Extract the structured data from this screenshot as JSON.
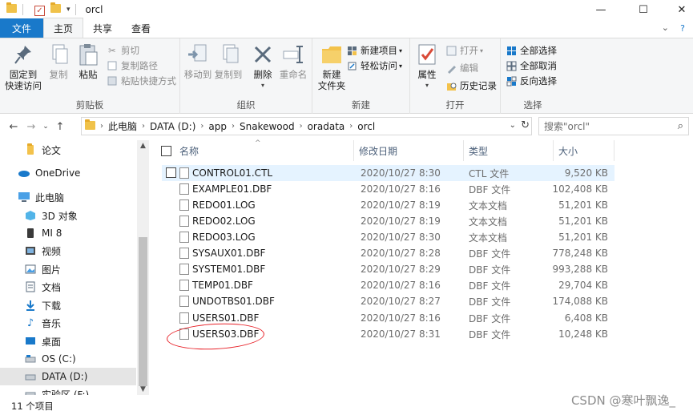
{
  "title": {
    "path_name": "orcl",
    "quick_access_dropdown": "▾"
  },
  "window_controls": {
    "minimize": "—",
    "maximize": "☐",
    "close": "✕"
  },
  "tabs": [
    {
      "label": "文件"
    },
    {
      "label": "主页"
    },
    {
      "label": "共享"
    },
    {
      "label": "查看"
    }
  ],
  "ribbon": {
    "clipboard": {
      "label": "剪贴板",
      "pin": "固定到\n快速访问",
      "copy": "复制",
      "paste": "粘贴",
      "cut": "剪切",
      "copy_path": "复制路径",
      "paste_shortcut": "粘贴快捷方式"
    },
    "organize": {
      "label": "组织",
      "move_to": "移动到",
      "copy_to": "复制到",
      "delete": "删除",
      "rename": "重命名"
    },
    "new": {
      "label": "新建",
      "new_folder": "新建\n文件夹",
      "new_item": "新建项目",
      "easy_access": "轻松访问"
    },
    "open": {
      "label": "打开",
      "properties": "属性",
      "open": "打开",
      "edit": "编辑",
      "history": "历史记录"
    },
    "select": {
      "label": "选择",
      "select_all": "全部选择",
      "select_none": "全部取消",
      "invert": "反向选择"
    }
  },
  "address": {
    "segments": [
      "此电脑",
      "DATA (D:)",
      "app",
      "Snakewood",
      "oradata",
      "orcl"
    ]
  },
  "search": {
    "placeholder": "搜索\"orcl\""
  },
  "sidebar": {
    "items": [
      {
        "label": "论文",
        "icon": "folder-icon"
      },
      {
        "label": "OneDrive",
        "icon": "cloud-icon"
      },
      {
        "label": "此电脑",
        "icon": "computer-icon"
      },
      {
        "label": "3D 对象",
        "icon": "cube-icon"
      },
      {
        "label": "MI 8",
        "icon": "phone-icon"
      },
      {
        "label": "视频",
        "icon": "video-icon"
      },
      {
        "label": "图片",
        "icon": "picture-icon"
      },
      {
        "label": "文档",
        "icon": "document-icon"
      },
      {
        "label": "下载",
        "icon": "download-icon"
      },
      {
        "label": "音乐",
        "icon": "music-icon"
      },
      {
        "label": "桌面",
        "icon": "desktop-icon"
      },
      {
        "label": "OS (C:)",
        "icon": "drive-icon"
      },
      {
        "label": "DATA (D:)",
        "icon": "drive-icon"
      },
      {
        "label": "实验区 (F:)",
        "icon": "drive-icon"
      }
    ]
  },
  "columns": {
    "name": "名称",
    "date": "修改日期",
    "type": "类型",
    "size": "大小"
  },
  "files": [
    {
      "name": "CONTROL01.CTL",
      "date": "2020/10/27 8:30",
      "type": "CTL 文件",
      "size": "9,520 KB"
    },
    {
      "name": "EXAMPLE01.DBF",
      "date": "2020/10/27 8:16",
      "type": "DBF 文件",
      "size": "102,408 KB"
    },
    {
      "name": "REDO01.LOG",
      "date": "2020/10/27 8:19",
      "type": "文本文档",
      "size": "51,201 KB"
    },
    {
      "name": "REDO02.LOG",
      "date": "2020/10/27 8:19",
      "type": "文本文档",
      "size": "51,201 KB"
    },
    {
      "name": "REDO03.LOG",
      "date": "2020/10/27 8:30",
      "type": "文本文档",
      "size": "51,201 KB"
    },
    {
      "name": "SYSAUX01.DBF",
      "date": "2020/10/27 8:28",
      "type": "DBF 文件",
      "size": "778,248 KB"
    },
    {
      "name": "SYSTEM01.DBF",
      "date": "2020/10/27 8:29",
      "type": "DBF 文件",
      "size": "993,288 KB"
    },
    {
      "name": "TEMP01.DBF",
      "date": "2020/10/27 8:16",
      "type": "DBF 文件",
      "size": "29,704 KB"
    },
    {
      "name": "UNDOTBS01.DBF",
      "date": "2020/10/27 8:27",
      "type": "DBF 文件",
      "size": "174,088 KB"
    },
    {
      "name": "USERS01.DBF",
      "date": "2020/10/27 8:16",
      "type": "DBF 文件",
      "size": "6,408 KB"
    },
    {
      "name": "USERS03.DBF",
      "date": "2020/10/27 8:31",
      "type": "DBF 文件",
      "size": "10,248 KB"
    }
  ],
  "status": {
    "count": "11 个项目"
  },
  "watermark": "CSDN @寒叶飘逸_"
}
